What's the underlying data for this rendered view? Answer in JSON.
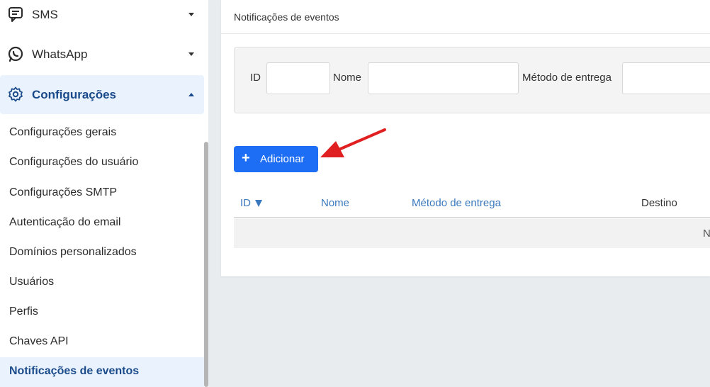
{
  "sidebar": {
    "nav": [
      {
        "label": "SMS",
        "icon": "sms-chat-icon",
        "expanded": false
      },
      {
        "label": "WhatsApp",
        "icon": "whatsapp-icon",
        "expanded": false
      },
      {
        "label": "Configurações",
        "icon": "gear-icon",
        "expanded": true
      }
    ],
    "sub_items": [
      "Configurações gerais",
      "Configurações do usuário",
      "Configurações SMTP",
      "Autenticação do email",
      "Domínios personalizados",
      "Usuários",
      "Perfis",
      "Chaves API",
      "Notificações de eventos"
    ],
    "active_sub_item": "Notificações de eventos"
  },
  "card": {
    "title": "Notificações de eventos",
    "filters": {
      "id_label": "ID",
      "id_value": "",
      "name_label": "Nome",
      "name_value": "",
      "method_label": "Método de entrega",
      "method_value": ""
    },
    "add_button": {
      "icon": "plus-icon",
      "label": "Adicionar"
    },
    "table": {
      "columns": [
        "ID",
        "Nome",
        "Método de entrega",
        "Destino"
      ],
      "sorted_column": "ID",
      "sort_direction": "descending",
      "empty_text": "N"
    }
  },
  "colors": {
    "accent": "#1d6ef5",
    "active_text": "#1a4a8a",
    "active_bg": "#eaf3fd",
    "column_link": "#3a78bd",
    "annotation_arrow": "#e02020"
  }
}
